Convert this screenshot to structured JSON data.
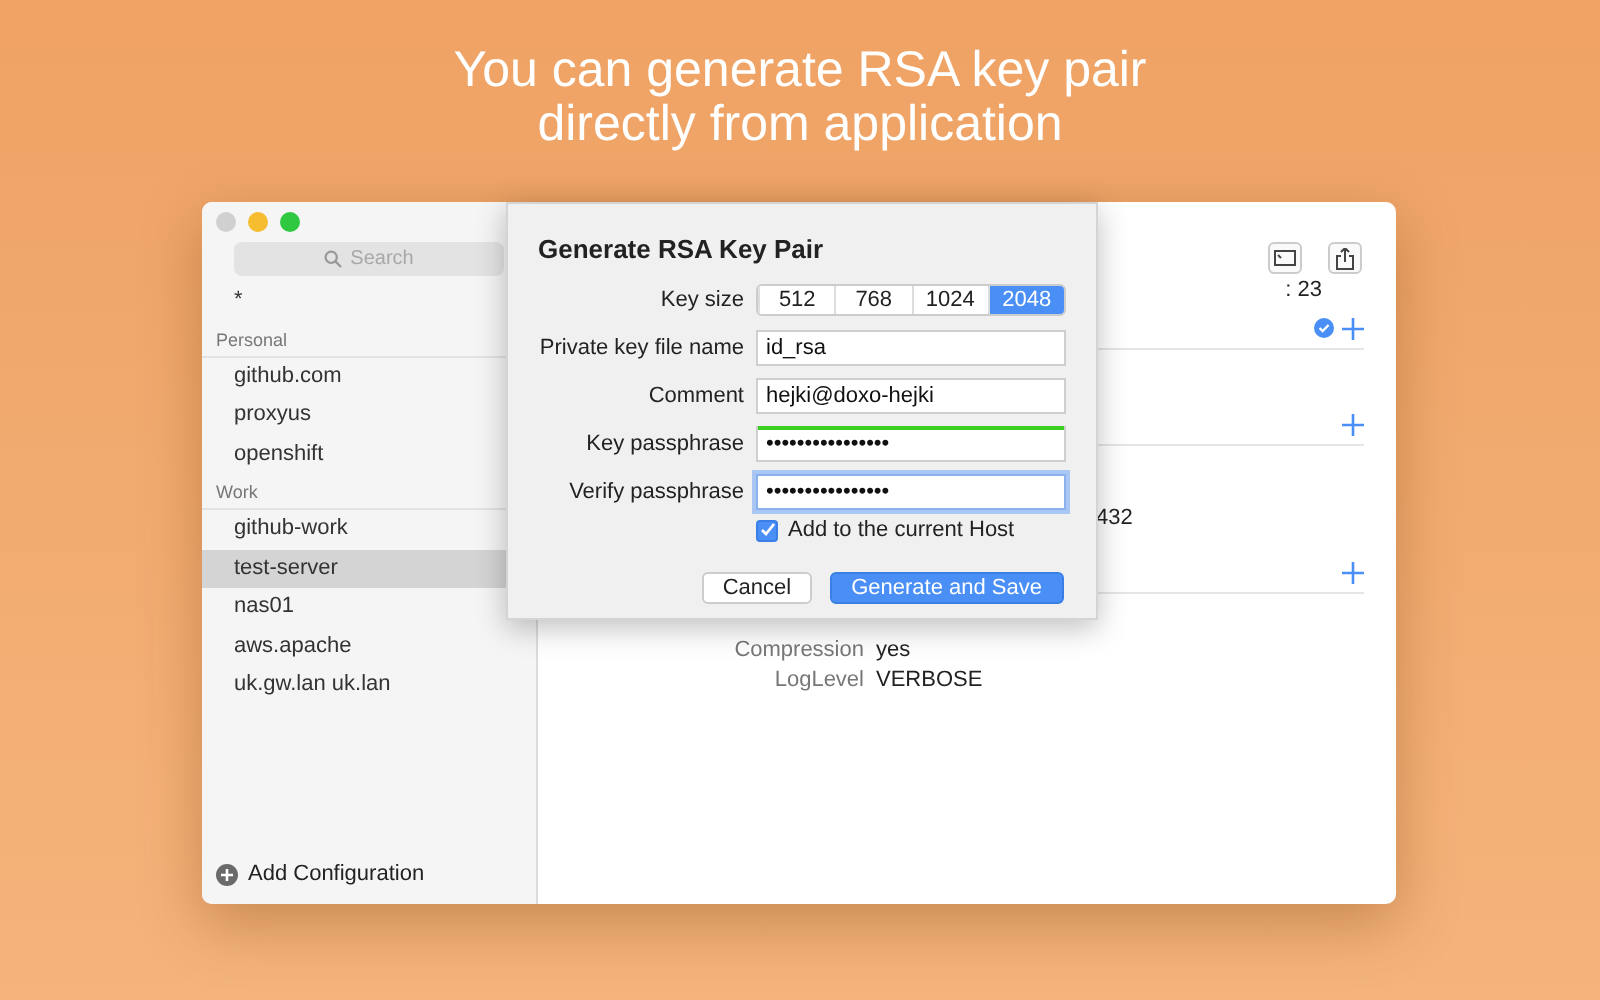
{
  "headline": [
    "You can generate RSA key pair",
    "directly from application"
  ],
  "sidebar": {
    "search": {
      "placeholder": "Search"
    },
    "sections": [
      {
        "items": [
          {
            "label": "*",
            "selected": false
          }
        ]
      },
      {
        "title": "Personal",
        "items": [
          {
            "label": "github.com",
            "selected": false
          },
          {
            "label": "proxyus",
            "selected": false
          },
          {
            "label": "openshift",
            "selected": false
          }
        ]
      },
      {
        "title": "Work",
        "items": [
          {
            "label": "github-work",
            "selected": false
          },
          {
            "label": "test-server",
            "selected": true
          },
          {
            "label": "nas01",
            "selected": false
          },
          {
            "label": "aws.apache",
            "selected": false
          },
          {
            "label": "uk.gw.lan uk.lan",
            "selected": false
          }
        ]
      }
    ],
    "add_button": "Add Configuration"
  },
  "main": {
    "port_value": ": 23",
    "value": "432",
    "properties": [
      {
        "label": "Compression",
        "value": "yes"
      },
      {
        "label": "LogLevel",
        "value": "VERBOSE"
      }
    ]
  },
  "dialog": {
    "title": "Generate RSA Key Pair",
    "key_size": {
      "label": "Key size",
      "options": [
        {
          "label": "512",
          "selected": false
        },
        {
          "label": "768",
          "selected": false
        },
        {
          "label": "1024",
          "selected": false
        },
        {
          "label": "2048",
          "selected": true
        }
      ]
    },
    "fields": [
      {
        "label": "Private key file name",
        "value": "id_rsa",
        "focused": false
      },
      {
        "label": "Comment",
        "value": "hejki@doxo-hejki",
        "focused": false
      },
      {
        "label": "Key passphrase",
        "value": "••••••••••••••••",
        "focused": false,
        "level": 1
      },
      {
        "label": "Verify passphrase",
        "value": "••••••••••••••••",
        "focused": true
      }
    ],
    "checkbox": {
      "label": "Add to the current Host",
      "checked": true
    },
    "buttons": [
      {
        "label": "Cancel",
        "kind": "default"
      },
      {
        "label": "Generate and Save",
        "kind": "primary"
      }
    ]
  }
}
